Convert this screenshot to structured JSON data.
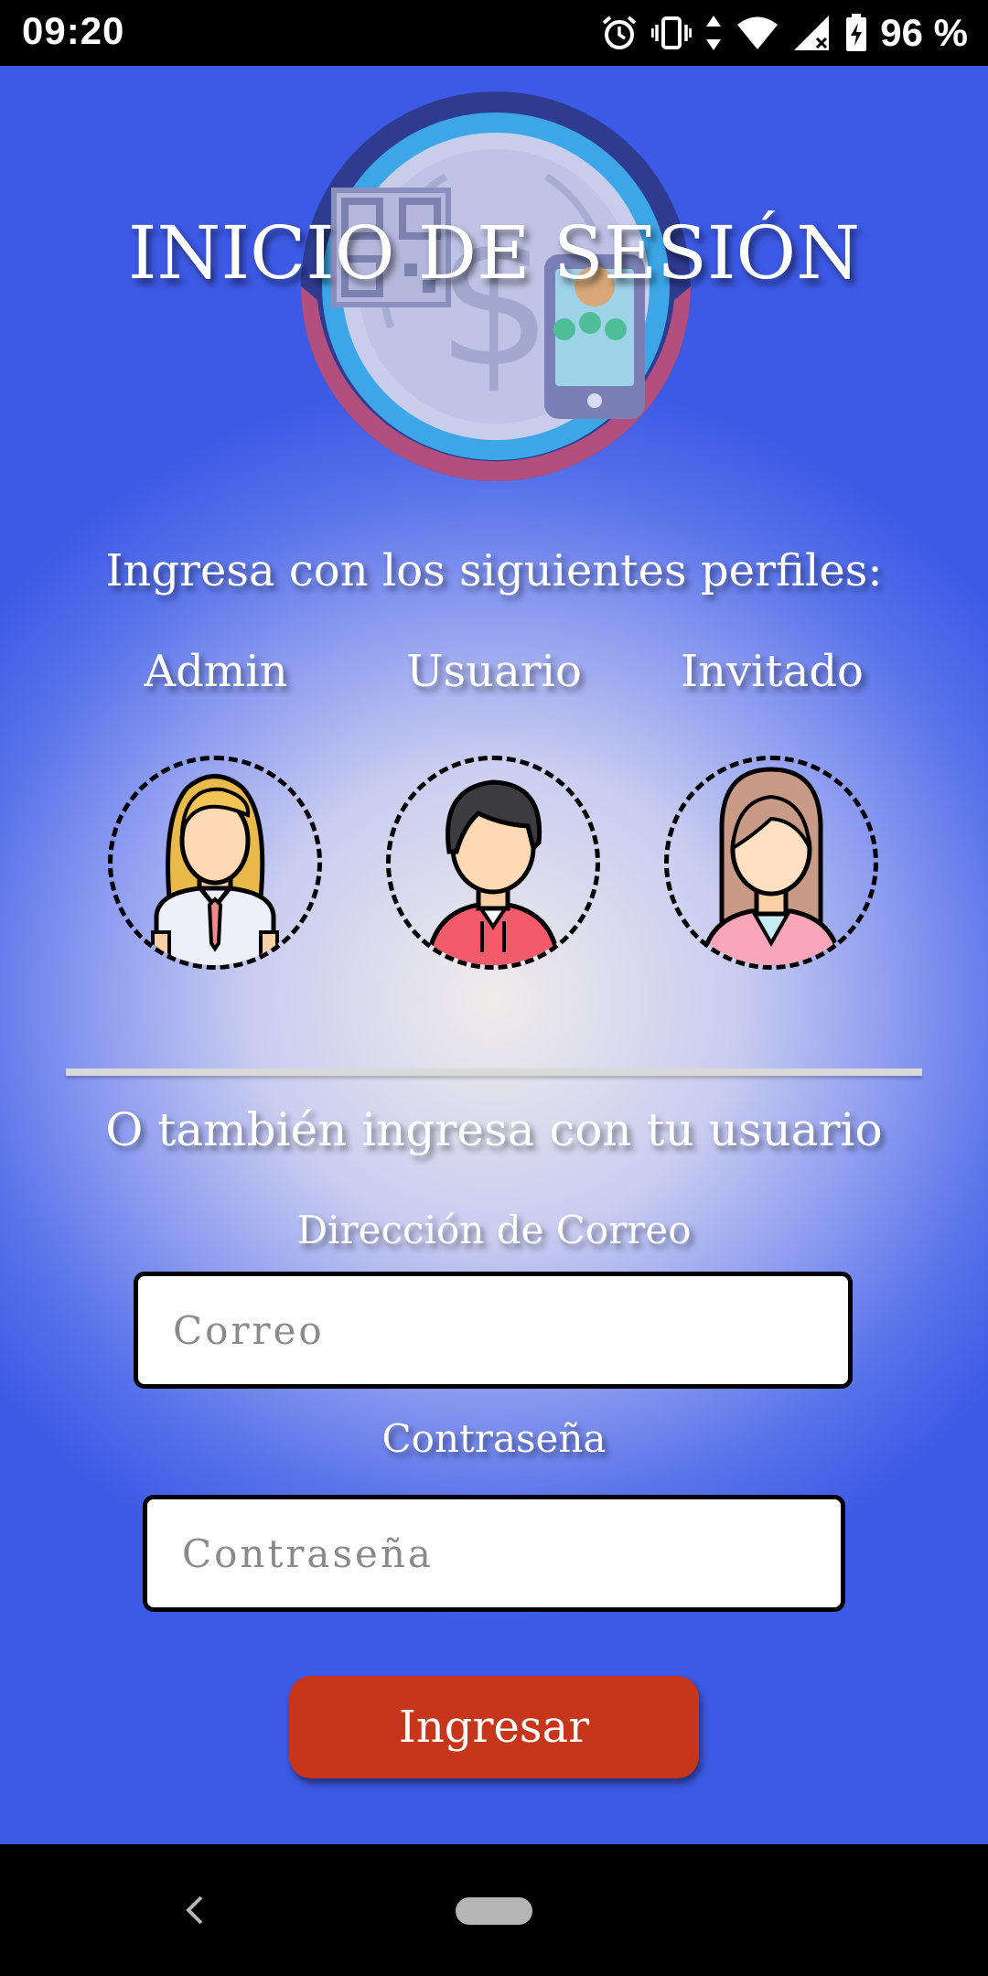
{
  "status_bar": {
    "time": "09:20",
    "battery_percent": "96 %",
    "icons": [
      "alarm-icon",
      "vibrate-icon",
      "wifi-icon",
      "signal-icon",
      "battery-icon"
    ]
  },
  "header": {
    "title": "INICIO DE SESIÓN",
    "logo_icon": "payment-logo-icon"
  },
  "profiles": {
    "heading": "Ingresa con los siguientes perfiles:",
    "items": [
      {
        "label": "Admin",
        "icon": "admin-avatar-icon"
      },
      {
        "label": "Usuario",
        "icon": "user-avatar-icon"
      },
      {
        "label": "Invitado",
        "icon": "guest-avatar-icon"
      }
    ]
  },
  "login_form": {
    "heading": "O también ingresa con tu usuario",
    "email_label": "Dirección de Correo",
    "email_placeholder": "Correo",
    "email_value": "",
    "password_label": "Contraseña",
    "password_placeholder": "Contraseña",
    "password_value": "",
    "submit_label": "Ingresar"
  },
  "colors": {
    "submit_button": "#c7361a",
    "background_edge": "#3d5ae6",
    "background_center": "#f0eceb"
  },
  "nav_bar": {
    "icons": [
      "back-icon",
      "home-pill-icon"
    ]
  }
}
